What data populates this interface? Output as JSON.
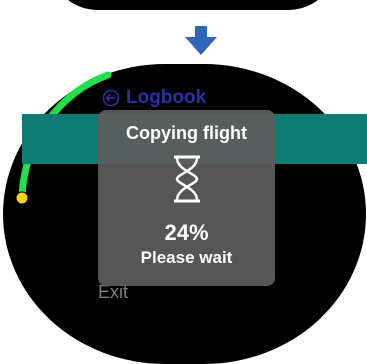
{
  "header": {
    "title": "Logbook"
  },
  "menu": {
    "exit_label": "Exit"
  },
  "popup": {
    "title": "Copying flight",
    "percent_text": "24%",
    "status": "Please wait",
    "progress": 0.24
  },
  "icons": {
    "arrow": "down-arrow-icon",
    "back": "back-icon",
    "hourglass": "hourglass-icon"
  },
  "colors": {
    "progress_arc": "#1ee04a",
    "progress_dot": "#f5d800",
    "highlight": "#0e7c72",
    "title": "#2e2ea6",
    "arrow": "#2f66b8"
  }
}
